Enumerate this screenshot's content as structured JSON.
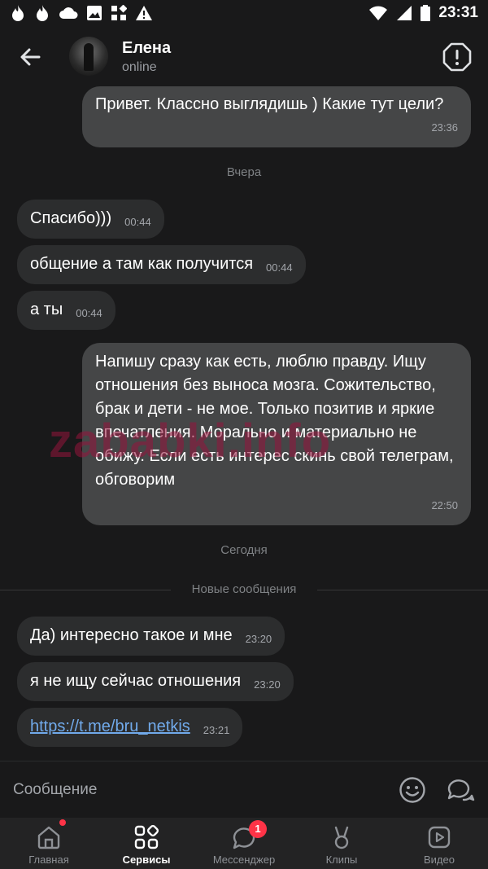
{
  "status_bar": {
    "time": "23:31",
    "left_icons": [
      "tinder-icon",
      "tinder-icon",
      "cloud-icon",
      "image-icon",
      "apps-icon",
      "warning-icon"
    ],
    "right_icons": [
      "wifi-icon",
      "signal-icon",
      "battery-icon"
    ]
  },
  "header": {
    "contact_name": "Елена",
    "contact_status": "online"
  },
  "messages": {
    "m1": {
      "text": "Привет. Классно выглядишь ) Какие тут цели?",
      "time": "23:36"
    },
    "sep_yesterday": "Вчера",
    "m2": {
      "text": "Спасибо)))",
      "time": "00:44"
    },
    "m3": {
      "text": "общение а там как получится",
      "time": "00:44"
    },
    "m4": {
      "text": "а ты",
      "time": "00:44"
    },
    "m5": {
      "text": "Напишу сразу как есть, люблю правду. Ищу отношения без выноса мозга. Сожительство, брак и дети - не мое. Только позитив и яркие впечатления. Морально и материально не обижу. Если есть интерес скинь свой телеграм, обговорим",
      "time": "22:50"
    },
    "sep_today": "Сегодня",
    "new_messages": "Новые сообщения",
    "m6": {
      "text": "Да) интересно такое и мне",
      "time": "23:20"
    },
    "m7": {
      "text": "я не ищу сейчас отношения",
      "time": "23:20"
    },
    "m8": {
      "text": "https://t.me/bru_netkis",
      "time": "23:21"
    }
  },
  "watermark": "zababki.info",
  "composer": {
    "placeholder": "Сообщение"
  },
  "tabs": {
    "home": "Главная",
    "services": "Сервисы",
    "messenger": "Мессенджер",
    "messenger_badge": "1",
    "clips": "Клипы",
    "video": "Видео"
  },
  "colors": {
    "background": "#19191a",
    "incoming_bubble": "#2c2d2e",
    "outgoing_bubble": "#454647",
    "link": "#71aaeb",
    "badge": "#ff3347"
  }
}
